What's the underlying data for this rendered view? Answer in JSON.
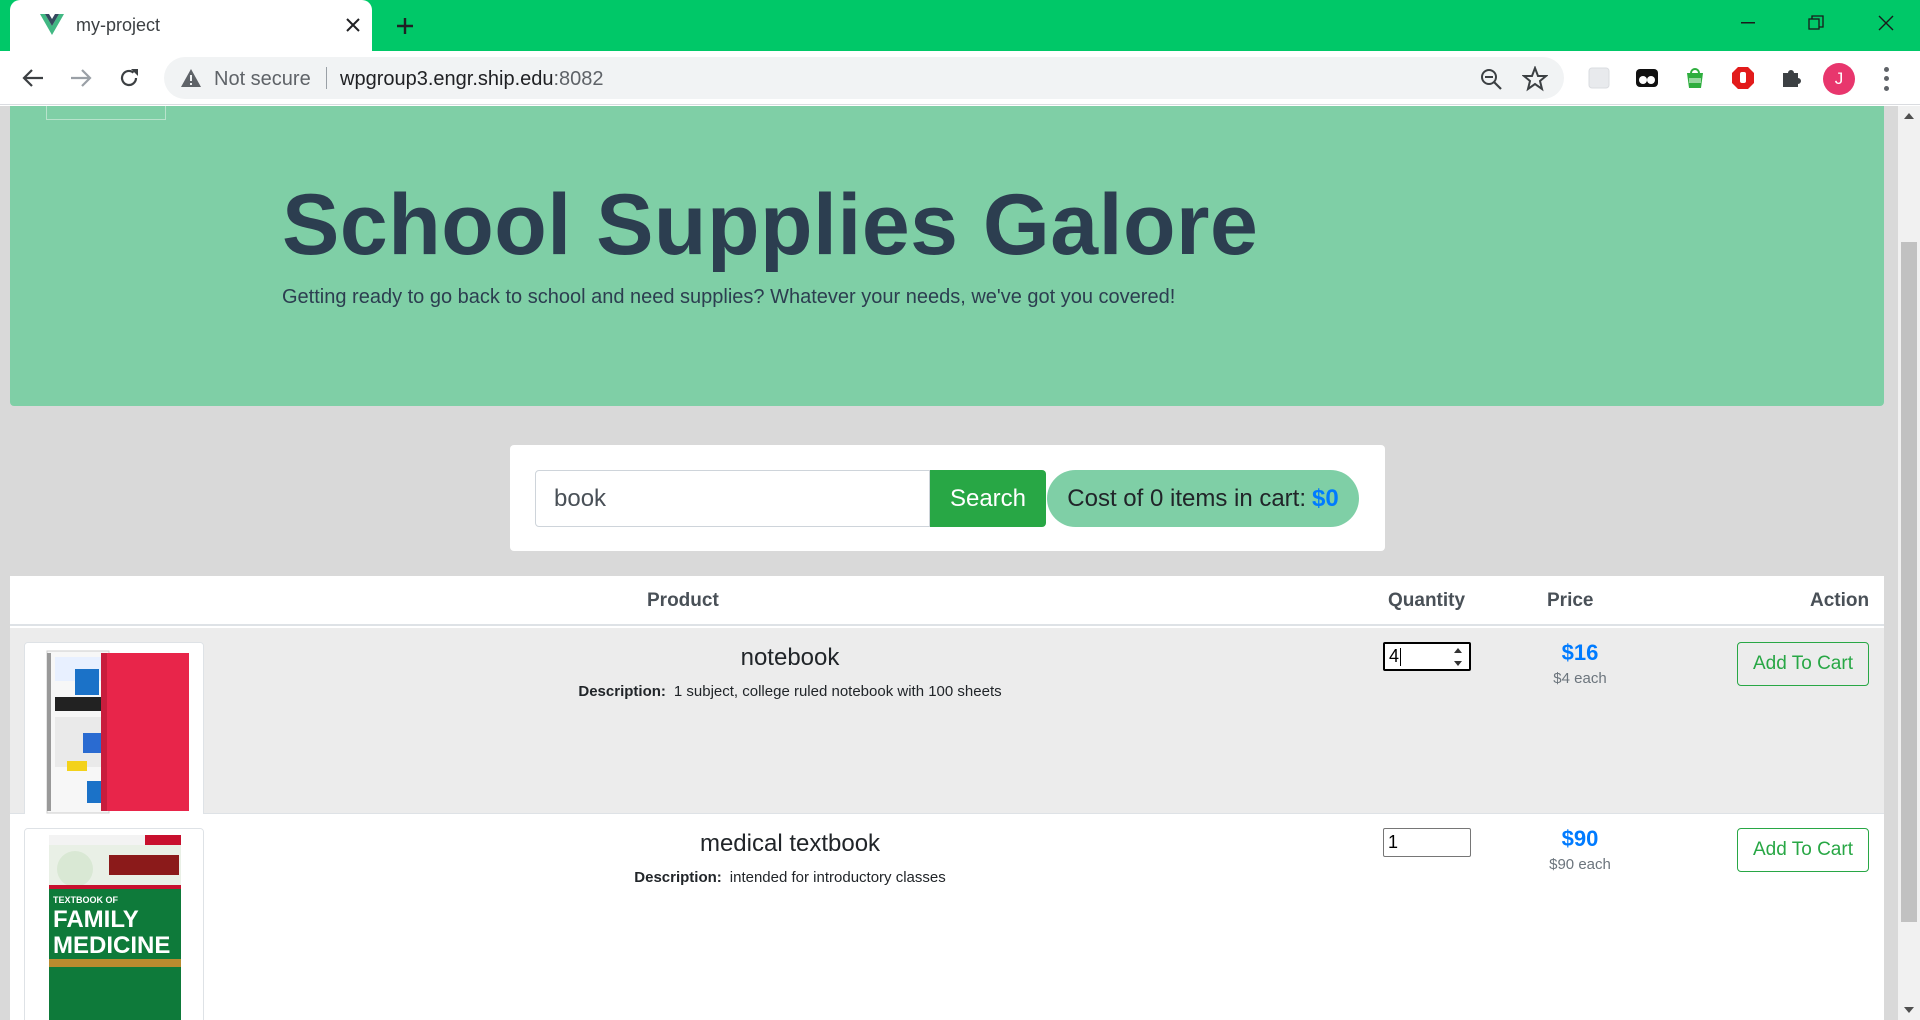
{
  "browser": {
    "tab_title": "my-project",
    "not_secure": "Not secure",
    "url_host": "wpgroup3.engr.ship.edu",
    "url_port": ":8082",
    "avatar_letter": "J"
  },
  "hero": {
    "title": "School Supplies Galore",
    "subtitle": "Getting ready to go back to school and need supplies? Whatever your needs, we've got you covered!"
  },
  "search": {
    "value": "book",
    "button_label": "Search"
  },
  "cart": {
    "label": "Cost of 0 items in cart:",
    "total": "$0"
  },
  "table": {
    "headers": {
      "product": "Product",
      "quantity": "Quantity",
      "price": "Price",
      "action": "Action"
    },
    "description_label": "Description:",
    "rows": [
      {
        "name": "notebook",
        "description": "1 subject, college ruled notebook with 100 sheets",
        "quantity": "4",
        "price": "$16",
        "each": "$4 each",
        "action_label": "Add To Cart"
      },
      {
        "name": "medical textbook",
        "description": "intended for introductory classes",
        "quantity": "1",
        "price": "$90",
        "each": "$90 each",
        "action_label": "Add To Cart"
      }
    ]
  },
  "images": {
    "textbook_cover_lines": [
      "TEXTBOOK OF",
      "FAMILY",
      "MEDICINE"
    ]
  },
  "colors": {
    "browser_frame": "#00c868",
    "hero_bg": "#7fcfa6",
    "success": "#28a745",
    "link_blue": "#007bff"
  }
}
